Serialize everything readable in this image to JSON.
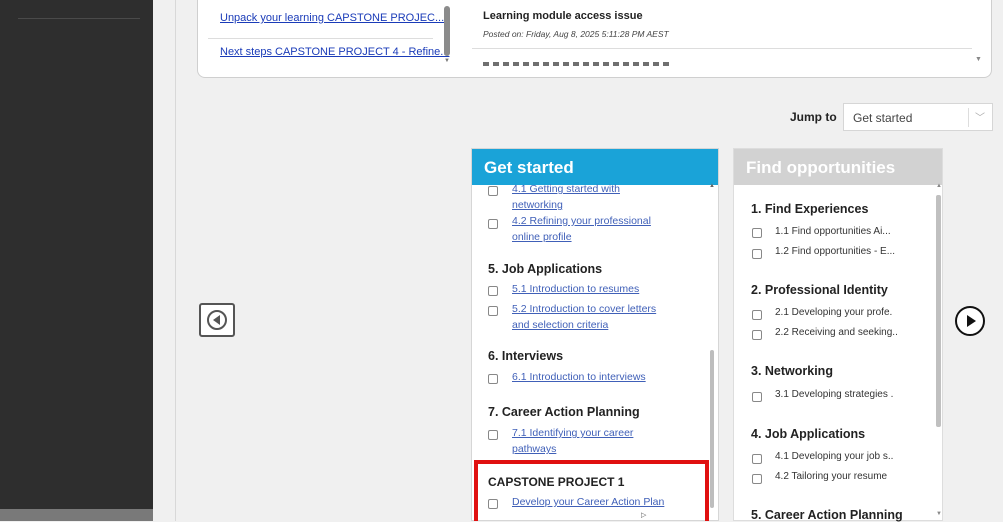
{
  "sidebar_links": {
    "link1": "Unpack your learning CAPSTONE PROJEC...",
    "link2": "Next steps CAPSTONE PROJECT 4 - Refine..."
  },
  "notice": {
    "title": "Learning module access issue",
    "date": "Posted on: Friday, Aug 8, 2025 5:11:28 PM AEST"
  },
  "jump": {
    "label": "Jump to",
    "selected": "Get started"
  },
  "get_started": {
    "title": "Get started",
    "items": {
      "i41": "4.1 Getting started with",
      "i41b": "networking",
      "i42": "4.2 Refining your professional",
      "i42b": "online profile",
      "s5": "5. Job Applications",
      "i51": "5.1 Introduction to resumes",
      "i52": "5.2 Introduction to cover letters",
      "i52b": "and selection criteria",
      "s6": "6. Interviews",
      "i61": "6.1 Introduction to interviews",
      "s7": "7. Career Action Planning",
      "i71": "7.1 Identifying your career",
      "i71b": "pathways",
      "cap": "CAPSTONE PROJECT 1",
      "capi": "Develop your Career Action Plan"
    }
  },
  "find_opps": {
    "title": "Find opportunities",
    "s1": "1. Find Experiences",
    "i11": "1.1 Find opportunities Ai...",
    "i12": "1.2 Find opportunities - E...",
    "s2": "2. Professional Identity",
    "i21": "2.1 Developing your profe.",
    "i22": "2.2 Receiving and seeking..",
    "s3": "3. Networking",
    "i31": "3.1 Developing strategies .",
    "s4": "4. Job Applications",
    "i41": "4.1 Developing your job s..",
    "i42": "4.2 Tailoring your resume",
    "s5": "5. Career Action Planning"
  },
  "colors": {
    "accent": "#1aa3d8",
    "highlight": "#e01010",
    "sidebar_bg": "#2e2e2e"
  }
}
